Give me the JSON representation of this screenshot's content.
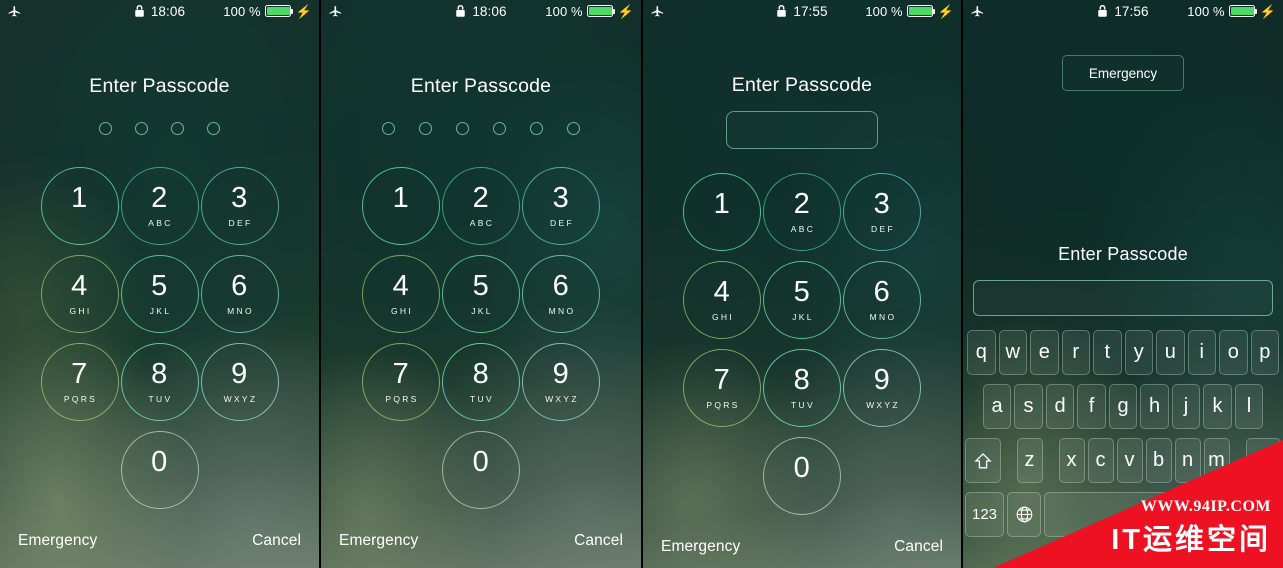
{
  "meta": {
    "accent_green": "#4cd964",
    "ring_green": "#6ed7b4",
    "watermark_red": "#ee1122"
  },
  "status_bar": {
    "airplane_icon": "airplane-mode-icon",
    "lock_icon": "lock-closed-icon",
    "battery_icon": "battery-full-icon",
    "charging_icon": "lightning-bolt-icon",
    "battery_percent": "100 %"
  },
  "keypad": {
    "keys": [
      {
        "digit": "1",
        "letters": ""
      },
      {
        "digit": "2",
        "letters": "ABC"
      },
      {
        "digit": "3",
        "letters": "DEF"
      },
      {
        "digit": "4",
        "letters": "GHI"
      },
      {
        "digit": "5",
        "letters": "JKL"
      },
      {
        "digit": "6",
        "letters": "MNO"
      },
      {
        "digit": "7",
        "letters": "PQRS"
      },
      {
        "digit": "8",
        "letters": "TUV"
      },
      {
        "digit": "9",
        "letters": "WXYZ"
      },
      {
        "digit": "0",
        "letters": ""
      }
    ]
  },
  "panels": [
    {
      "id": "panel-1-four-digit-passcode",
      "time": "18:06",
      "title": "Enter Passcode",
      "dot_count": 4,
      "emergency_label": "Emergency",
      "cancel_label": "Cancel"
    },
    {
      "id": "panel-2-six-digit-passcode",
      "time": "18:06",
      "title": "Enter Passcode",
      "dot_count": 6,
      "emergency_label": "Emergency",
      "cancel_label": "Cancel"
    },
    {
      "id": "panel-3-custom-numeric-passcode",
      "time": "17:55",
      "title": "Enter Passcode",
      "field_value": "",
      "emergency_label": "Emergency",
      "cancel_label": "Cancel"
    },
    {
      "id": "panel-4-alphanumeric-passcode",
      "time": "17:56",
      "title": "Enter Passcode",
      "emergency_label": "Emergency",
      "field_value": ""
    }
  ],
  "keyboard": {
    "row1": [
      "q",
      "w",
      "e",
      "r",
      "t",
      "y",
      "u",
      "i",
      "o",
      "p"
    ],
    "row2": [
      "a",
      "s",
      "d",
      "f",
      "g",
      "h",
      "j",
      "k",
      "l"
    ],
    "row3": [
      "z",
      "x",
      "c",
      "v",
      "b",
      "n",
      "m"
    ],
    "shift_icon": "shift-up-arrow-icon",
    "backspace_icon": "backspace-delete-icon",
    "numeric_label": "123",
    "globe_icon": "globe-language-icon",
    "space_label": ""
  },
  "watermark": {
    "url": "WWW.94IP.COM",
    "brand": "IT运维空间"
  }
}
